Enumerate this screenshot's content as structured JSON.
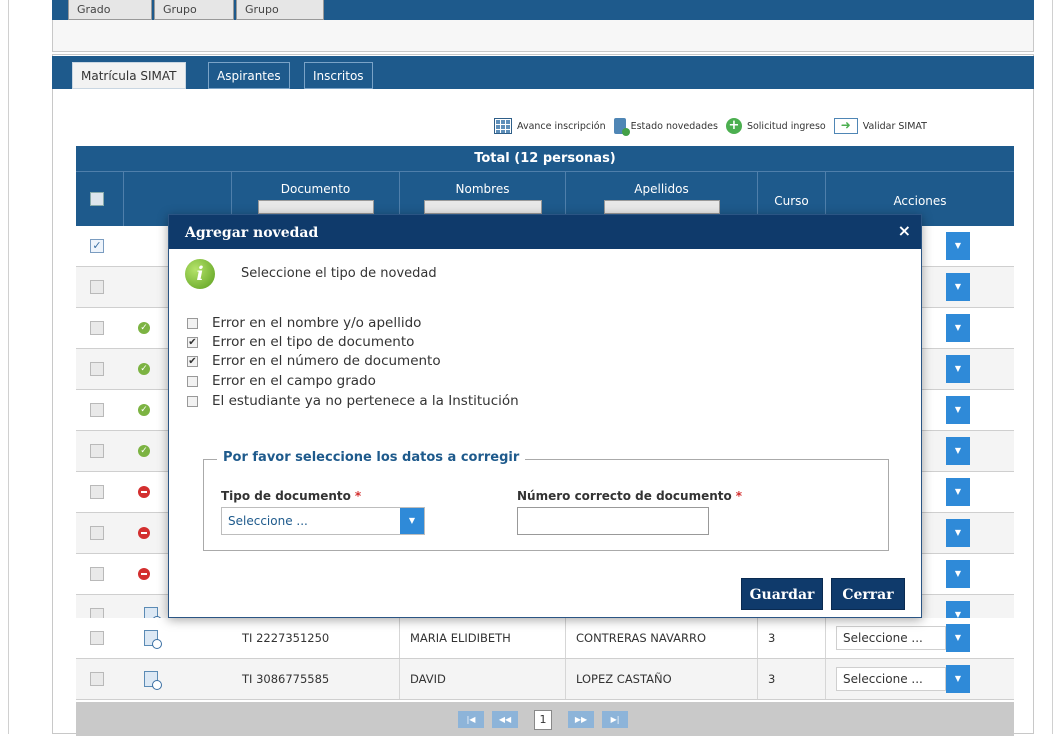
{
  "top_tabs": [
    "Grado",
    "Grupo",
    "Grupo"
  ],
  "main_tabs": [
    {
      "label": "Matrícula SIMAT",
      "active": true
    },
    {
      "label": "Aspirantes",
      "active": false
    },
    {
      "label": "Inscritos",
      "active": false
    }
  ],
  "toolbar": {
    "avance": "Avance inscripción",
    "estado": "Estado novedades",
    "solicitud": "Solicitud ingreso",
    "validar": "Validar SIMAT"
  },
  "grid": {
    "total": "Total (12 personas)",
    "columns": {
      "documento": "Documento",
      "nombres": "Nombres",
      "apellidos": "Apellidos",
      "curso": "Curso",
      "acciones": "Acciones"
    },
    "rows": [
      {
        "status": "doc",
        "documento": "TI 2227351250",
        "nombres": "MARIA ELIDIBETH",
        "apellidos": "CONTRERAS NAVARRO",
        "curso": "3",
        "accion": "Seleccione ..."
      },
      {
        "status": "doc",
        "documento": "TI 3086775585",
        "nombres": "DAVID",
        "apellidos": "LOPEZ CASTAÑO",
        "curso": "3",
        "accion": "Seleccione ..."
      }
    ],
    "pager": {
      "page": "1"
    }
  },
  "modal": {
    "title": "Agregar novedad",
    "close": "×",
    "prompt": "Seleccione el tipo de novedad",
    "options": [
      {
        "label": "Error en el nombre y/o apellido",
        "checked": false
      },
      {
        "label": "Error en el tipo de documento",
        "checked": true
      },
      {
        "label": "Error en el número de documento",
        "checked": true
      },
      {
        "label": "Error en el campo grado",
        "checked": false
      },
      {
        "label": "El estudiante ya no pertenece a la Institución",
        "checked": false
      }
    ],
    "fieldset_legend": "Por favor seleccione los datos a corregir",
    "tipo_label": "Tipo de documento",
    "numero_label": "Número correcto de documento",
    "required_mark": "*",
    "tipo_value": "Seleccione ...",
    "numero_value": "",
    "guardar": "Guardar",
    "cerrar": "Cerrar"
  },
  "colors": {
    "primary": "#1e5a8c",
    "modal_header": "#0f3a6b",
    "accent_button": "#2f8ad8",
    "ok": "#7cb342",
    "error": "#d32f2f"
  }
}
